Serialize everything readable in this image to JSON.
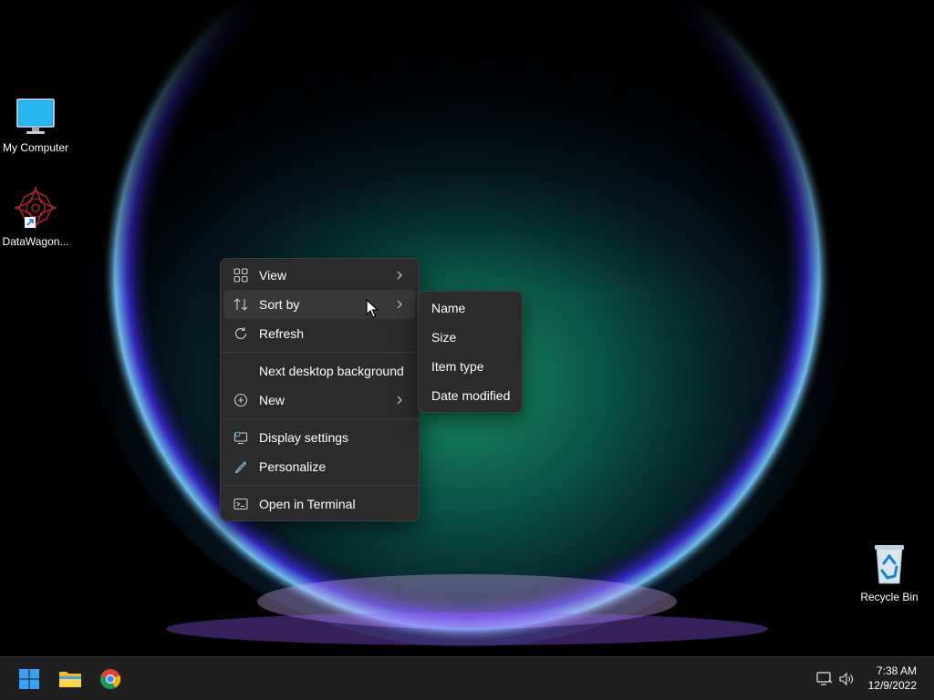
{
  "desktop": {
    "icons": [
      {
        "label": "My Computer",
        "icon": "monitor-icon"
      },
      {
        "label": "DataWagon...",
        "icon": "datawagon-app-icon"
      },
      {
        "label": "Recycle Bin",
        "icon": "recycle-bin-icon"
      }
    ]
  },
  "context_menu": {
    "items": [
      {
        "label": "View",
        "icon": "grid-view-icon",
        "submenu": true
      },
      {
        "label": "Sort by",
        "icon": "sort-icon",
        "submenu": true,
        "active": true
      },
      {
        "label": "Refresh",
        "icon": "refresh-icon"
      },
      {
        "label": "Next desktop background",
        "icon": ""
      },
      {
        "label": "New",
        "icon": "plus-circle-icon",
        "submenu": true
      },
      {
        "label": "Display settings",
        "icon": "display-settings-icon"
      },
      {
        "label": "Personalize",
        "icon": "pen-icon"
      },
      {
        "label": "Open in Terminal",
        "icon": "terminal-icon"
      }
    ]
  },
  "sort_submenu": {
    "items": [
      "Name",
      "Size",
      "Item type",
      "Date modified"
    ]
  },
  "taskbar": {
    "apps": [
      "windows-start-icon",
      "file-explorer-icon",
      "chrome-icon"
    ],
    "tray": [
      "network-icon",
      "volume-icon"
    ],
    "time": "7:38 AM",
    "date": "12/9/2022"
  },
  "colors": {
    "menu_bg": "#2b2b2b",
    "menu_active": "#383838",
    "taskbar_bg": "#1f1f1f",
    "accent": "#0078d4"
  }
}
